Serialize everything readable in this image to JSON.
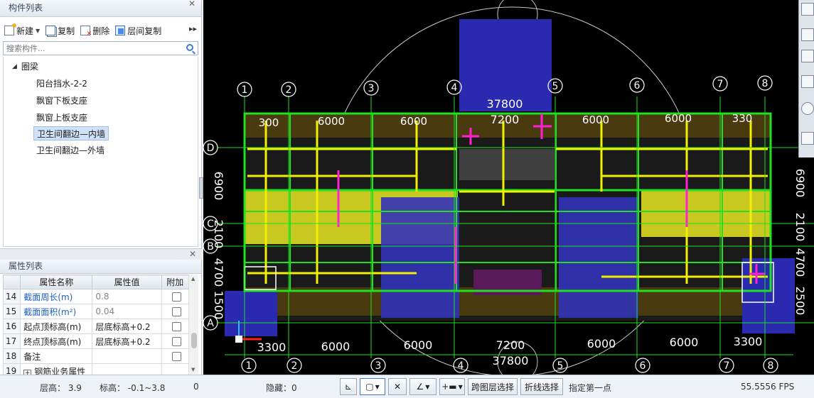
{
  "comp_panel": {
    "title": "构件列表",
    "toolbar": {
      "new": "新建",
      "copy": "复制",
      "delete": "删除",
      "floor_copy": "层间复制",
      "more": "▸▸"
    },
    "search_placeholder": "搜索构件...",
    "tree": {
      "root": "圈梁",
      "items": [
        "阳台挡水-2-2",
        "飘窗下板支座",
        "飘窗上板支座",
        "卫生间翻边—内墙",
        "卫生间翻边—外墙"
      ],
      "selected_index": 3
    }
  },
  "prop_panel": {
    "title": "属性列表",
    "headers": [
      "属性名称",
      "属性值",
      "附加"
    ],
    "rows": [
      {
        "num": "14",
        "name": "截面周长(m)",
        "value": "0.8"
      },
      {
        "num": "15",
        "name": "截面面积(m²)",
        "value": "0.04"
      },
      {
        "num": "16",
        "name": "起点顶标高(m)",
        "value": "层底标高+0.2"
      },
      {
        "num": "17",
        "name": "终点顶标高(m)",
        "value": "层底标高+0.2"
      },
      {
        "num": "18",
        "name": "备注",
        "value": ""
      },
      {
        "num": "19",
        "name": "钢筋业务属性",
        "value": ""
      }
    ]
  },
  "viewport": {
    "top_grid_labels": [
      "1",
      "2",
      "3",
      "4",
      "5",
      "6",
      "7",
      "8"
    ],
    "bottom_grid_labels": [
      "1",
      "2",
      "3",
      "4",
      "5",
      "6",
      "7",
      "8"
    ],
    "top_dims": [
      "300",
      "6000",
      "6000",
      "7200",
      "6000",
      "6000",
      "330"
    ],
    "top_total": "37800",
    "bottom_dims": [
      "3300",
      "6000",
      "6000",
      "7200",
      "6000",
      "6000",
      "3300"
    ],
    "bottom_total": "37800",
    "left_dims": [
      "6900",
      "2100",
      "4700",
      "1500"
    ],
    "right_dims": [
      "6900",
      "2100",
      "4700",
      "2500"
    ],
    "left_axes": [
      "D",
      "C",
      "B",
      "A"
    ],
    "colors": {
      "outline": "#20e020",
      "beam": "#f0f000",
      "slab": "#2020a0",
      "magenta": "#ff20d0"
    }
  },
  "statusbar": {
    "floor_height": "层高： 3.9",
    "elevation": "标高： -0.1~3.8",
    "zero": "0",
    "hidden": "隐藏：0",
    "cross_floor": "跨图层选择",
    "polyline": "折线选择",
    "hint": "指定第一点",
    "fps": "55.5556 FPS"
  }
}
